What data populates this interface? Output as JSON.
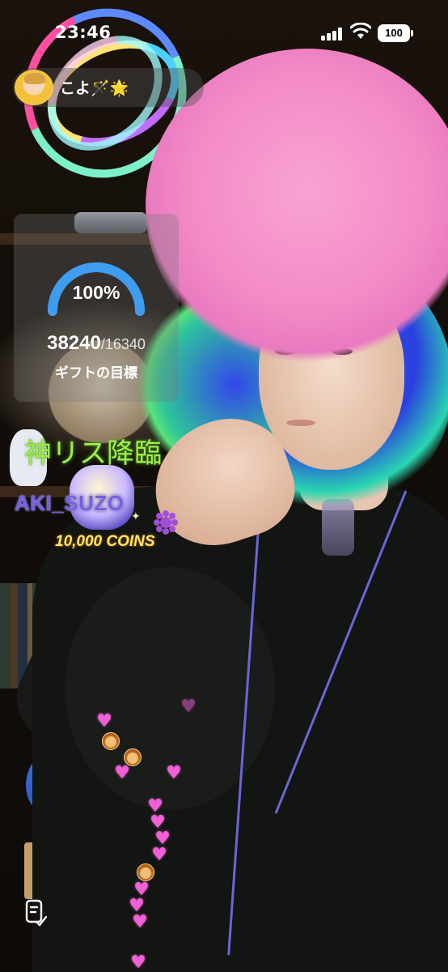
{
  "status_bar": {
    "time": "23:46",
    "battery": "100",
    "signal_icon": "signal-bars-icon",
    "wifi_icon": "wifi-icon"
  },
  "host": {
    "name": "こよ🪄🌟",
    "avatar_icon": "host-avatar-icon"
  },
  "gift_goal": {
    "percent_label": "100%",
    "progress": 1.0,
    "current": "38240",
    "total": "/16340",
    "label": "ギフトの目標",
    "gauge_color": "#3f9df0"
  },
  "gift_banner": {
    "title": "神リス降臨",
    "sender": "AKI_SUZO",
    "amount": "10,000 COINS",
    "title_color": "#9cf04b",
    "sender_color": "#7460e0",
    "amount_color": "#ffe46a"
  },
  "reactions": {
    "heart_color": "#f25fd8",
    "heart_icon": "heart-icon",
    "emoji_icon": "face-emoji-icon"
  },
  "bottom": {
    "menu_icon": "notes-icon"
  }
}
